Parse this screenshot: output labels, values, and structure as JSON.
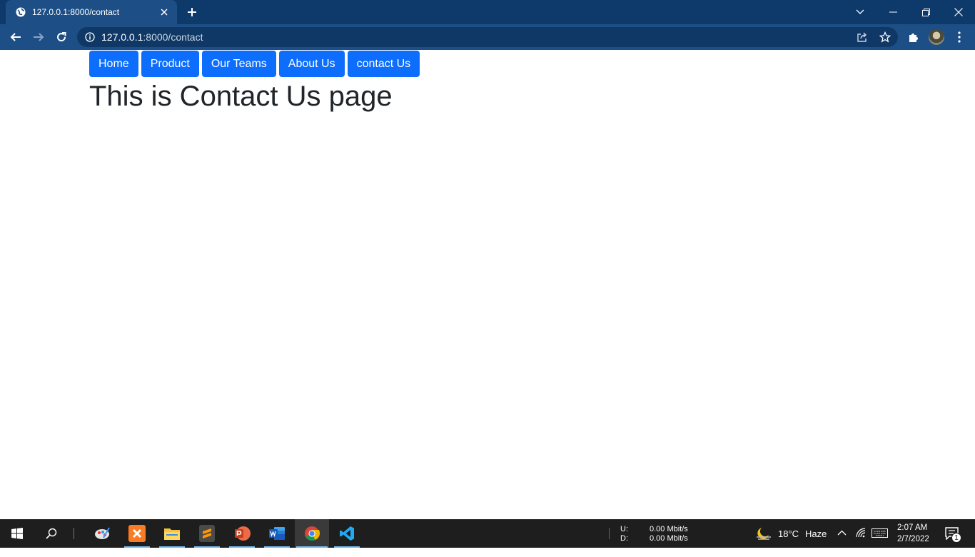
{
  "browser": {
    "tab_title": "127.0.0.1:8000/contact",
    "url_host": "127.0.0.1",
    "url_path": ":8000/contact"
  },
  "nav": {
    "items": [
      {
        "label": "Home"
      },
      {
        "label": "Product"
      },
      {
        "label": "Our Teams"
      },
      {
        "label": "About Us"
      },
      {
        "label": "contact Us"
      }
    ]
  },
  "page": {
    "heading": "This is Contact Us page"
  },
  "taskbar": {
    "net_up_label": "U:",
    "net_down_label": "D:",
    "net_up_value": "0.00 Mbit/s",
    "net_down_value": "0.00 Mbit/s",
    "temperature": "18°C",
    "weather": "Haze",
    "time": "2:07 AM",
    "date": "2/7/2022",
    "notification_count": "1"
  },
  "colors": {
    "nav_button": "#0d6efd",
    "tab_strip": "#0e3a6b",
    "toolbar": "#1d4f86",
    "heading": "#212529"
  }
}
